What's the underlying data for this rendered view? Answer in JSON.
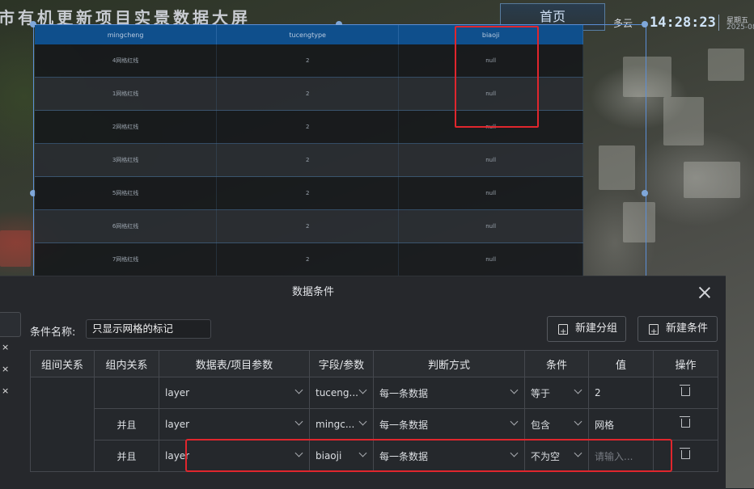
{
  "header": {
    "title": "市有机更新项目实景数据大屏",
    "home_button": "首页",
    "weather": "多云",
    "time": "14:28:23",
    "weekday": "星期五",
    "date": "2025-08"
  },
  "data_table": {
    "columns": [
      "mingcheng",
      "tucengtype",
      "biaoji"
    ],
    "rows": [
      [
        "4网格红线",
        "2",
        "null"
      ],
      [
        "1网格红线",
        "2",
        "null"
      ],
      [
        "2网格红线",
        "2",
        "null"
      ],
      [
        "3网格红线",
        "2",
        "null"
      ],
      [
        "5网格红线",
        "2",
        "null"
      ],
      [
        "6网格红线",
        "2",
        "null"
      ],
      [
        "7网格红线",
        "2",
        "null"
      ]
    ]
  },
  "dialog": {
    "title": "数据条件",
    "condition_name_label": "条件名称:",
    "condition_name_value": "只显示网格的标记",
    "new_group_button": "新建分组",
    "new_condition_button": "新建条件",
    "table_headers": [
      "组间关系",
      "组内关系",
      "数据表/项目参数",
      "字段/参数",
      "判断方式",
      "条件",
      "值",
      "操作"
    ],
    "rows": [
      {
        "intra": "",
        "table": "layer",
        "field": "tuceng...",
        "method": "每一条数据",
        "condition": "等于",
        "value": "2",
        "placeholder": ""
      },
      {
        "intra": "并且",
        "table": "layer",
        "field": "mingc...",
        "method": "每一条数据",
        "condition": "包含",
        "value": "网格",
        "placeholder": ""
      },
      {
        "intra": "并且",
        "table": "layer",
        "field": "biaoji",
        "method": "每一条数据",
        "condition": "不为空",
        "value": "",
        "placeholder": "请输入..."
      }
    ]
  },
  "side_marks": [
    "×",
    "×",
    "×"
  ]
}
